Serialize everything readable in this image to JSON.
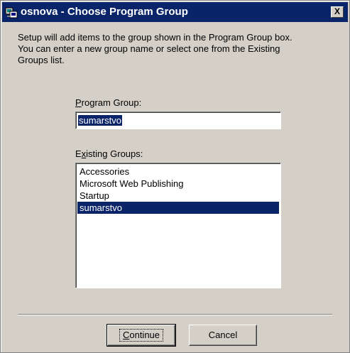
{
  "window": {
    "title": "osnova - Choose Program Group",
    "close_label": "X"
  },
  "description": [
    "Setup will add items to the group shown in the Program Group box.",
    "You can enter a new group name or select one from the Existing",
    "Groups list."
  ],
  "program_group": {
    "label_accel": "P",
    "label_rest": "rogram Group:",
    "value": "sumarstvo"
  },
  "existing_groups": {
    "label_pre": "E",
    "label_accel": "x",
    "label_rest": "isting Groups:",
    "items": [
      "Accessories",
      "Microsoft Web Publishing",
      "Startup",
      "sumarstvo"
    ],
    "selected_index": 3
  },
  "buttons": {
    "continue_accel": "C",
    "continue_rest": "ontinue",
    "cancel": "Cancel"
  }
}
